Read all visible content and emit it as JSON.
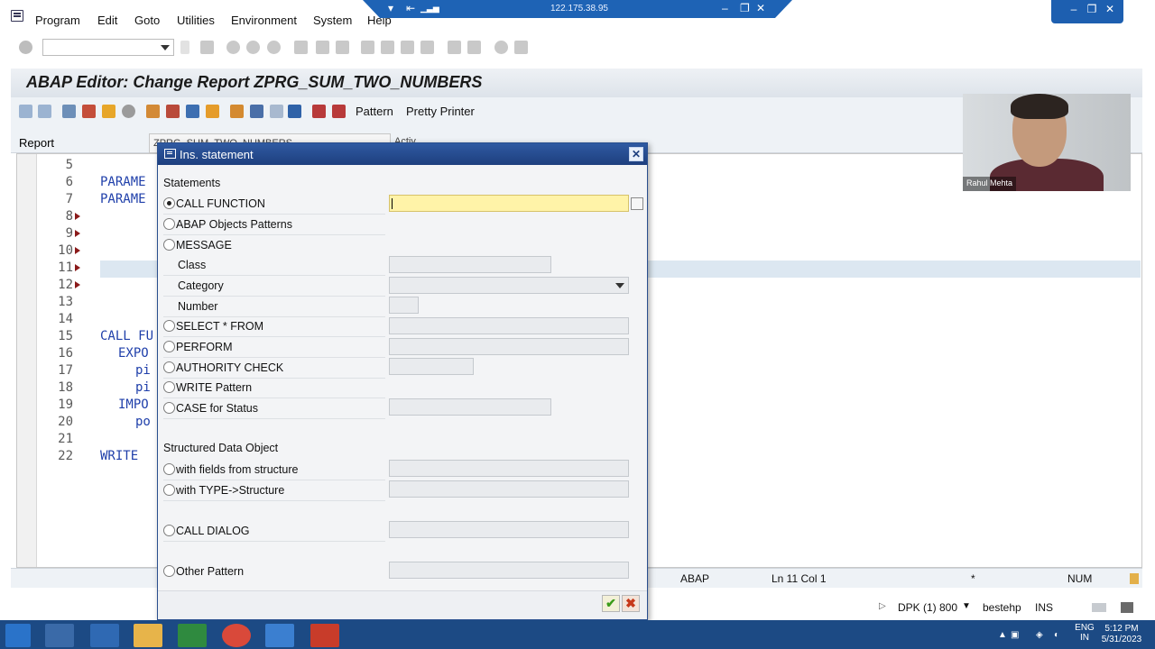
{
  "menu": [
    "Program",
    "Edit",
    "Goto",
    "Utilities",
    "Environment",
    "System",
    "Help"
  ],
  "remote_bar": {
    "ip": "122.175.38.95"
  },
  "page_title": "ABAP Editor: Change Report ZPRG_SUM_TWO_NUMBERS",
  "app_toolbar": {
    "pattern_label": "Pattern",
    "pretty_printer_label": "Pretty Printer"
  },
  "report_row": {
    "label": "Report",
    "value": "ZPRG_SUM_TWO_NUMBERS",
    "status_partial": "Activ"
  },
  "editor": {
    "line_numbers": [
      "5",
      "6",
      "7",
      "8",
      "9",
      "10",
      "11",
      "12",
      "13",
      "14",
      "15",
      "16",
      "17",
      "18",
      "19",
      "20",
      "21",
      "22"
    ],
    "code_visible": [
      "PARAME",
      "PARAME",
      "CALL FU",
      "EXPO",
      "pi",
      "pi",
      "IMPO",
      "po",
      "WRITE"
    ]
  },
  "status_bar": {
    "mode": "ABAP",
    "position": "Ln  11 Col  1",
    "marker": "*",
    "num": "NUM"
  },
  "system_bar": {
    "system": "DPK (1) 800",
    "server": "bestehp",
    "ins": "INS"
  },
  "dialog": {
    "title": "Ins. statement",
    "section_statements": "Statements",
    "options": {
      "call_function": "CALL FUNCTION",
      "abap_objects_patterns": "ABAP Objects Patterns",
      "message": "MESSAGE",
      "class": "Class",
      "category": "Category",
      "number": "Number",
      "select_from": "SELECT * FROM",
      "perform": "PERFORM",
      "authority_check": "AUTHORITY CHECK",
      "write_pattern": "WRITE Pattern",
      "case_for_status": "CASE for Status",
      "with_fields_from_structure": "with fields from structure",
      "with_type_structure": "with TYPE->Structure",
      "call_dialog": "CALL DIALOG",
      "other_pattern": "Other Pattern"
    },
    "section_structured": "Structured Data Object",
    "selected_option": "CALL FUNCTION",
    "ok_glyph": "✔",
    "cancel_glyph": "✖"
  },
  "webcam": {
    "name": "Rahul Mehta"
  },
  "taskbar": {
    "lang": "ENG",
    "region": "IN",
    "time": "5:12 PM",
    "date": "5/31/2023"
  }
}
